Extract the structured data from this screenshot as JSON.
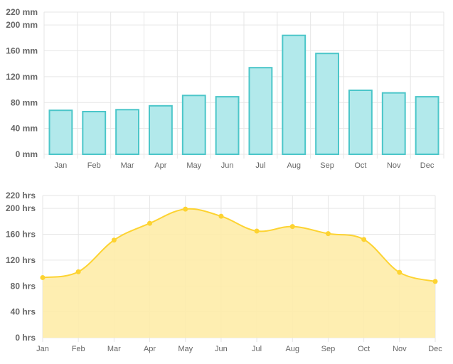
{
  "chart_data": [
    {
      "type": "bar",
      "categories": [
        "Jan",
        "Feb",
        "Mar",
        "Apr",
        "May",
        "Jun",
        "Jul",
        "Aug",
        "Sep",
        "Oct",
        "Nov",
        "Dec"
      ],
      "values": [
        68,
        66,
        69,
        75,
        91,
        89,
        134,
        184,
        156,
        99,
        95,
        89
      ],
      "unit_suffix": " mm",
      "yticks": [
        0,
        40,
        80,
        120,
        160,
        200,
        220
      ],
      "ylim": [
        0,
        220
      ],
      "grid": true,
      "colors": {
        "fill": "#b2e9eb",
        "stroke": "#4bc6c9"
      }
    },
    {
      "type": "area",
      "categories": [
        "Jan",
        "Feb",
        "Mar",
        "Apr",
        "May",
        "Jun",
        "Jul",
        "Aug",
        "Sep",
        "Oct",
        "Nov",
        "Dec"
      ],
      "values": [
        93,
        102,
        151,
        177,
        199,
        188,
        165,
        172,
        161,
        152,
        101,
        87
      ],
      "unit_suffix": " hrs",
      "yticks": [
        0,
        40,
        80,
        120,
        160,
        200,
        220
      ],
      "ylim": [
        0,
        220
      ],
      "grid": true,
      "colors": {
        "fill": "#feeca8",
        "stroke": "#fdd331",
        "point": "#fdd331"
      }
    }
  ]
}
